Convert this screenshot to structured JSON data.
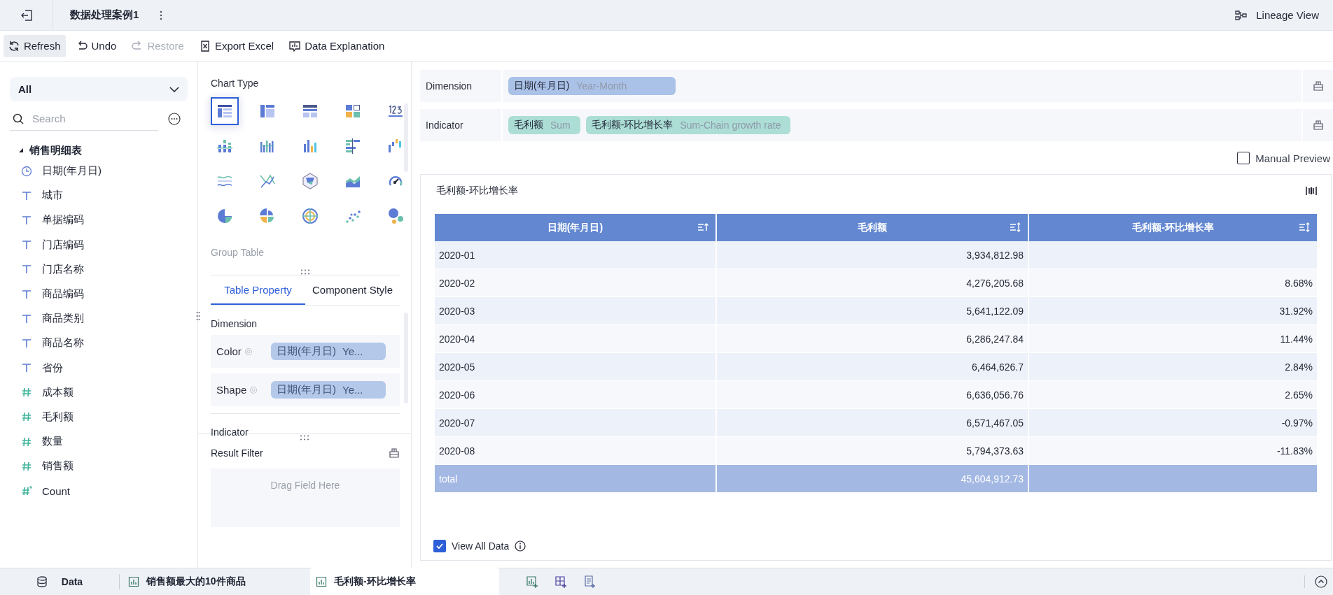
{
  "header": {
    "title": "数据处理案例1",
    "lineage": "Lineage View"
  },
  "toolbar": [
    {
      "kind": "refresh",
      "label": "Refresh",
      "disabled": false,
      "selected": true
    },
    {
      "kind": "undo",
      "label": "Undo",
      "disabled": false,
      "selected": false
    },
    {
      "kind": "restore",
      "label": "Restore",
      "disabled": true,
      "selected": false
    },
    {
      "kind": "excel",
      "label": "Export Excel",
      "disabled": false,
      "selected": false
    },
    {
      "kind": "explain",
      "label": "Data Explanation",
      "disabled": false,
      "selected": false
    }
  ],
  "fields": {
    "filter": "All",
    "search_placeholder": "Search",
    "tree": [
      {
        "label": "销售明细表",
        "expanded": true,
        "children": [
          {
            "kind": "date",
            "label": "日期(年月日)"
          },
          {
            "kind": "text",
            "label": "城市"
          },
          {
            "kind": "text",
            "label": "单据编码"
          },
          {
            "kind": "text",
            "label": "门店编码"
          },
          {
            "kind": "text",
            "label": "门店名称"
          },
          {
            "kind": "text",
            "label": "商品编码"
          },
          {
            "kind": "text",
            "label": "商品类别"
          },
          {
            "kind": "text",
            "label": "商品名称"
          },
          {
            "kind": "text",
            "label": "省份"
          },
          {
            "kind": "number",
            "label": "成本额"
          },
          {
            "kind": "number",
            "label": "毛利额"
          },
          {
            "kind": "number",
            "label": "数量"
          },
          {
            "kind": "number",
            "label": "销售额"
          },
          {
            "kind": "count",
            "label": "Count"
          }
        ]
      }
    ]
  },
  "chart_panel": {
    "title": "Chart Type",
    "hint": "Group Table",
    "types": [
      {
        "kind": "table",
        "selected": true
      },
      {
        "kind": "crosstable",
        "selected": false
      },
      {
        "kind": "grouptable",
        "selected": false
      },
      {
        "kind": "card",
        "selected": false
      },
      {
        "kind": "number",
        "selected": false
      },
      {
        "kind": "stackbar",
        "selected": false
      },
      {
        "kind": "multibar",
        "selected": false
      },
      {
        "kind": "bar",
        "selected": false
      },
      {
        "kind": "hbar",
        "selected": false
      },
      {
        "kind": "waterfall",
        "selected": false
      },
      {
        "kind": "lines",
        "selected": false
      },
      {
        "kind": "crossline",
        "selected": false
      },
      {
        "kind": "radar",
        "selected": false
      },
      {
        "kind": "area",
        "selected": false
      },
      {
        "kind": "gauge",
        "selected": false
      },
      {
        "kind": "pie",
        "selected": false
      },
      {
        "kind": "rose",
        "selected": false
      },
      {
        "kind": "radial",
        "selected": false
      },
      {
        "kind": "scatter",
        "selected": false
      },
      {
        "kind": "bubble",
        "selected": false
      }
    ],
    "tabs": [
      {
        "label": "Table Property",
        "selected": true
      },
      {
        "label": "Component Style",
        "selected": false
      }
    ],
    "dimension_title": "Dimension",
    "attributes": [
      {
        "label": "Color",
        "field": "日期(年月日)",
        "agg": "Ye..."
      },
      {
        "label": "Shape",
        "field": "日期(年月日)",
        "agg": "Ye..."
      }
    ],
    "indicator_title": "Indicator",
    "result_filter": {
      "title": "Result Filter",
      "placeholder": "Drag Field Here"
    }
  },
  "shelves": [
    {
      "label": "Dimension",
      "pills": [
        {
          "kind": "dimension",
          "field": "日期(年月日)",
          "agg": "Year-Month"
        }
      ]
    },
    {
      "label": "Indicator",
      "pills": [
        {
          "kind": "measure",
          "field": "毛利额",
          "agg": "Sum"
        },
        {
          "kind": "measure",
          "field": "毛利额-环比增长率",
          "agg": "Sum-Chain growth rate"
        }
      ]
    }
  ],
  "manual_preview": {
    "label": "Manual Preview",
    "checked": false
  },
  "table": {
    "title": "毛利额-环比增长率",
    "columns": [
      {
        "label": "日期(年月日)",
        "sort_ascending": true
      },
      {
        "label": "毛利额",
        "sort_ascending": false
      },
      {
        "label": "毛利额-环比增长率",
        "sort_ascending": false
      }
    ],
    "rows": [
      [
        "2020-01",
        "3,934,812.98",
        null
      ],
      [
        "2020-02",
        "4,276,205.68",
        "8.68%"
      ],
      [
        "2020-03",
        "5,641,122.09",
        "31.92%"
      ],
      [
        "2020-04",
        "6,286,247.84",
        "11.44%"
      ],
      [
        "2020-05",
        "6,464,626.7",
        "2.84%"
      ],
      [
        "2020-06",
        "6,636,056.76",
        "2.65%"
      ],
      [
        "2020-07",
        "6,571,467.05",
        "-0.97%"
      ],
      [
        "2020-08",
        "5,794,373.63",
        "-11.83%"
      ]
    ],
    "total": {
      "label": "total",
      "value": "45,604,912.73"
    }
  },
  "view_all": {
    "label": "View All Data",
    "checked": true
  },
  "bottom_tabs": [
    {
      "kind": "data",
      "label": "Data",
      "selected": false
    },
    {
      "kind": "chart",
      "label": "销售额最大的10件商品",
      "selected": false
    },
    {
      "kind": "chart",
      "label": "毛利额-环比增长率",
      "selected": true
    }
  ]
}
